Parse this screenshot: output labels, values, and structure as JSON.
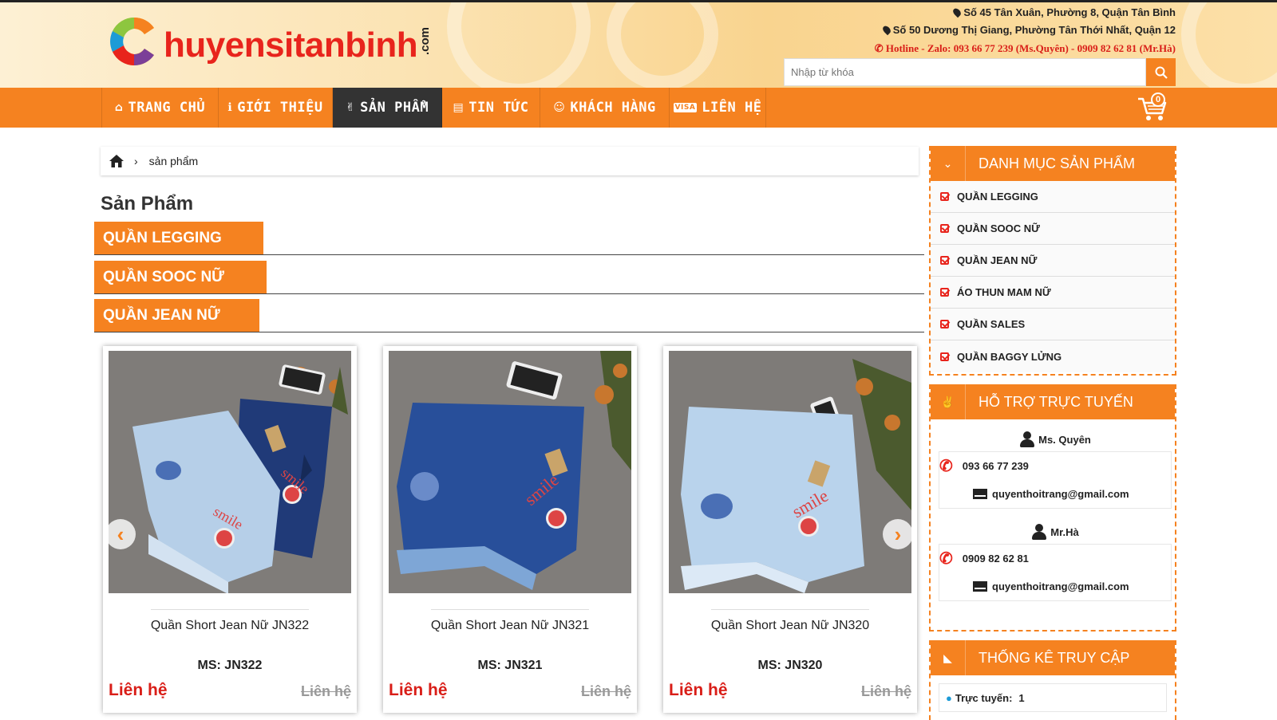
{
  "header": {
    "logo_c": "C",
    "logo_text": "huyensitanbinh",
    "logo_com": ".com",
    "address1": "Số 45 Tân Xuân, Phường 8, Quận Tân Bình",
    "address2": "Số 50 Dương Thị Giang, Phường Tân Thới Nhất, Quận 12",
    "hotline": "Hotline - Zalo: 093 66 77 239 (Ms.Quyên) - 0909 82 62 81 (Mr.Hà)",
    "search_placeholder": "Nhập từ khóa"
  },
  "nav": {
    "items": [
      {
        "label": "TRANG CHỦ",
        "icon": "home-icon"
      },
      {
        "label": "GIỚI THIỆU",
        "icon": "info-icon"
      },
      {
        "label": "SẢN PHẨM",
        "icon": "peace-hand-icon"
      },
      {
        "label": "TIN TỨC",
        "icon": "newspaper-icon"
      },
      {
        "label": "KHÁCH HÀNG",
        "icon": "smile-icon"
      },
      {
        "label": "LIÊN HỆ",
        "icon": "visa-card-icon"
      }
    ],
    "active": "SẢN PHẨM",
    "cart_count": "0"
  },
  "breadcrumb": {
    "current": "sản phẩm"
  },
  "main": {
    "title": "Sản Phẩm",
    "categories": [
      "QUẦN LEGGING",
      "QUẦN SOOC NỮ",
      "QUẦN JEAN NỮ"
    ],
    "products": [
      {
        "name": "Quần Short Jean Nữ JN322",
        "code": "MS: JN322",
        "price": "Liên hệ",
        "old_price": "Liên hệ"
      },
      {
        "name": "Quần Short Jean Nữ JN321",
        "code": "MS: JN321",
        "price": "Liên hệ",
        "old_price": "Liên hệ"
      },
      {
        "name": "Quần Short Jean Nữ JN320",
        "code": "MS: JN320",
        "price": "Liên hệ",
        "old_price": "Liên hệ"
      }
    ]
  },
  "sidebar": {
    "categories_title": "DANH MỤC SẢN PHẨM",
    "categories": [
      "QUẦN LEGGING",
      "QUẦN SOOC NỮ",
      "QUẦN JEAN NỮ",
      "ÁO THUN MAM NỮ",
      "QUẦN SALES",
      "QUẦN BAGGY LỬNG"
    ],
    "support_title": "HỖ TRỢ TRỰC TUYẾN",
    "support": [
      {
        "name": "Ms. Quyên",
        "phone": "093 66 77 239",
        "email": "quyenthoitrang@gmail.com"
      },
      {
        "name": "Mr.Hà",
        "phone": "0909 82 62 81",
        "email": "quyenthoitrang@gmail.com"
      }
    ],
    "stats_title": "THỐNG KÊ TRUY CẬP",
    "online_label": "Trực tuyến:",
    "online_count": "1"
  },
  "colors": {
    "accent": "#f58220",
    "price": "#d91e18",
    "active_nav": "#333333"
  }
}
